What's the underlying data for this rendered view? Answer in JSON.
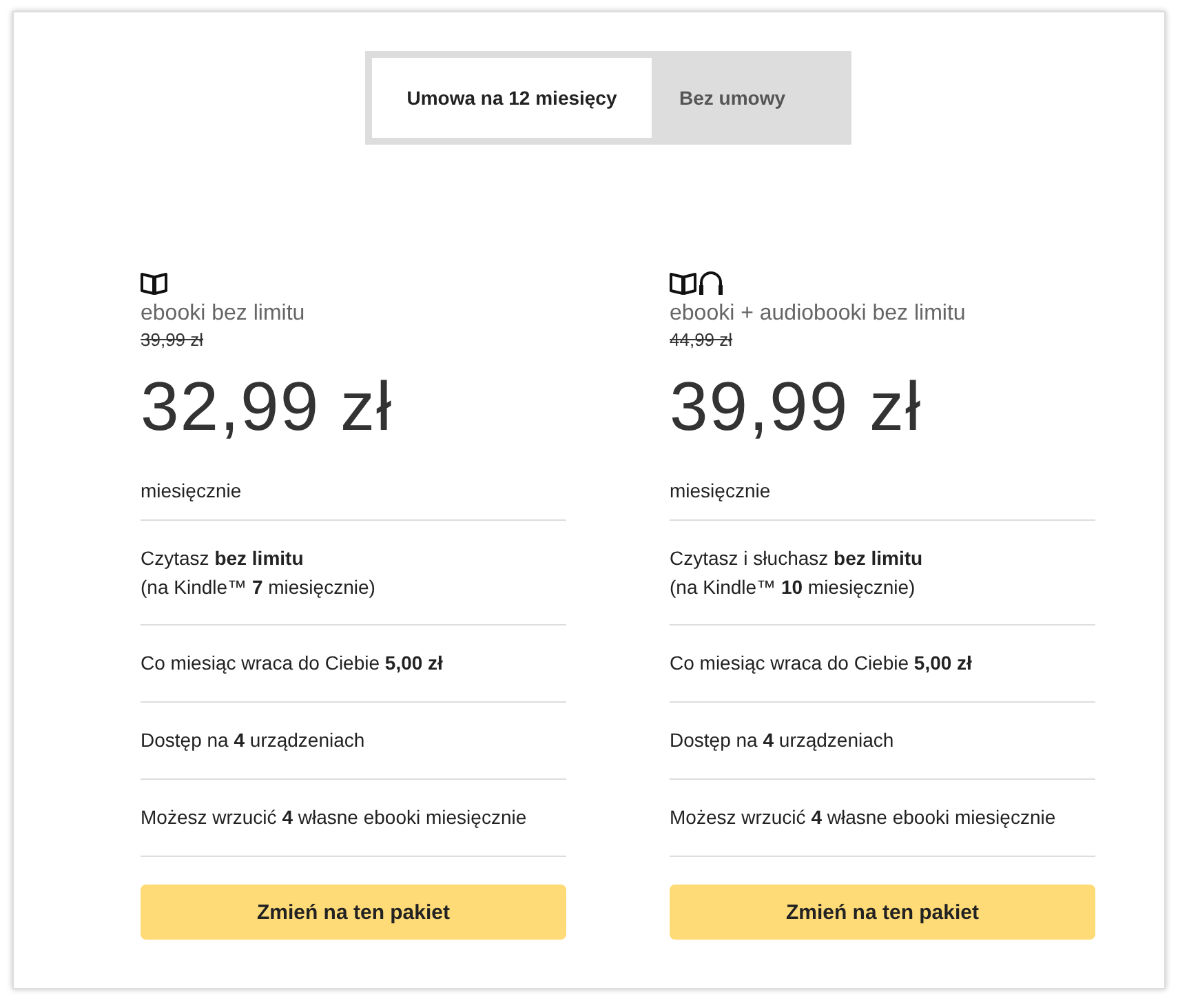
{
  "tabs": [
    {
      "label": "Umowa na 12 miesięcy",
      "selected": true
    },
    {
      "label": "Bez umowy",
      "selected": false
    }
  ],
  "plans": [
    {
      "kind": "ebook",
      "name": "ebooki bez limitu",
      "old_price": "39,99 zł",
      "price": "32,99 zł",
      "period": "miesięcznie",
      "features": [
        "Czytasz **bez limitu**\n(na Kindle™ **7** miesięcznie)",
        "Co miesiąc wraca do Ciebie **5,00 zł**",
        "Dostęp na **4** urządzeniach",
        "Możesz wrzucić **4** własne ebooki miesięcznie"
      ],
      "button": "Zmień na ten pakiet"
    },
    {
      "kind": "ebook_audio",
      "name": "ebooki + audiobooki bez limitu",
      "old_price": "44,99 zł",
      "price": "39,99 zł",
      "period": "miesięcznie",
      "features": [
        "Czytasz i słuchasz **bez limitu**\n(na Kindle™ **10** miesięcznie)",
        "Co miesiąc wraca do Ciebie **5,00 zł**",
        "Dostęp na **4** urządzeniach",
        "Możesz wrzucić **4** własne ebooki miesięcznie"
      ],
      "button": "Zmień na ten pakiet"
    }
  ]
}
